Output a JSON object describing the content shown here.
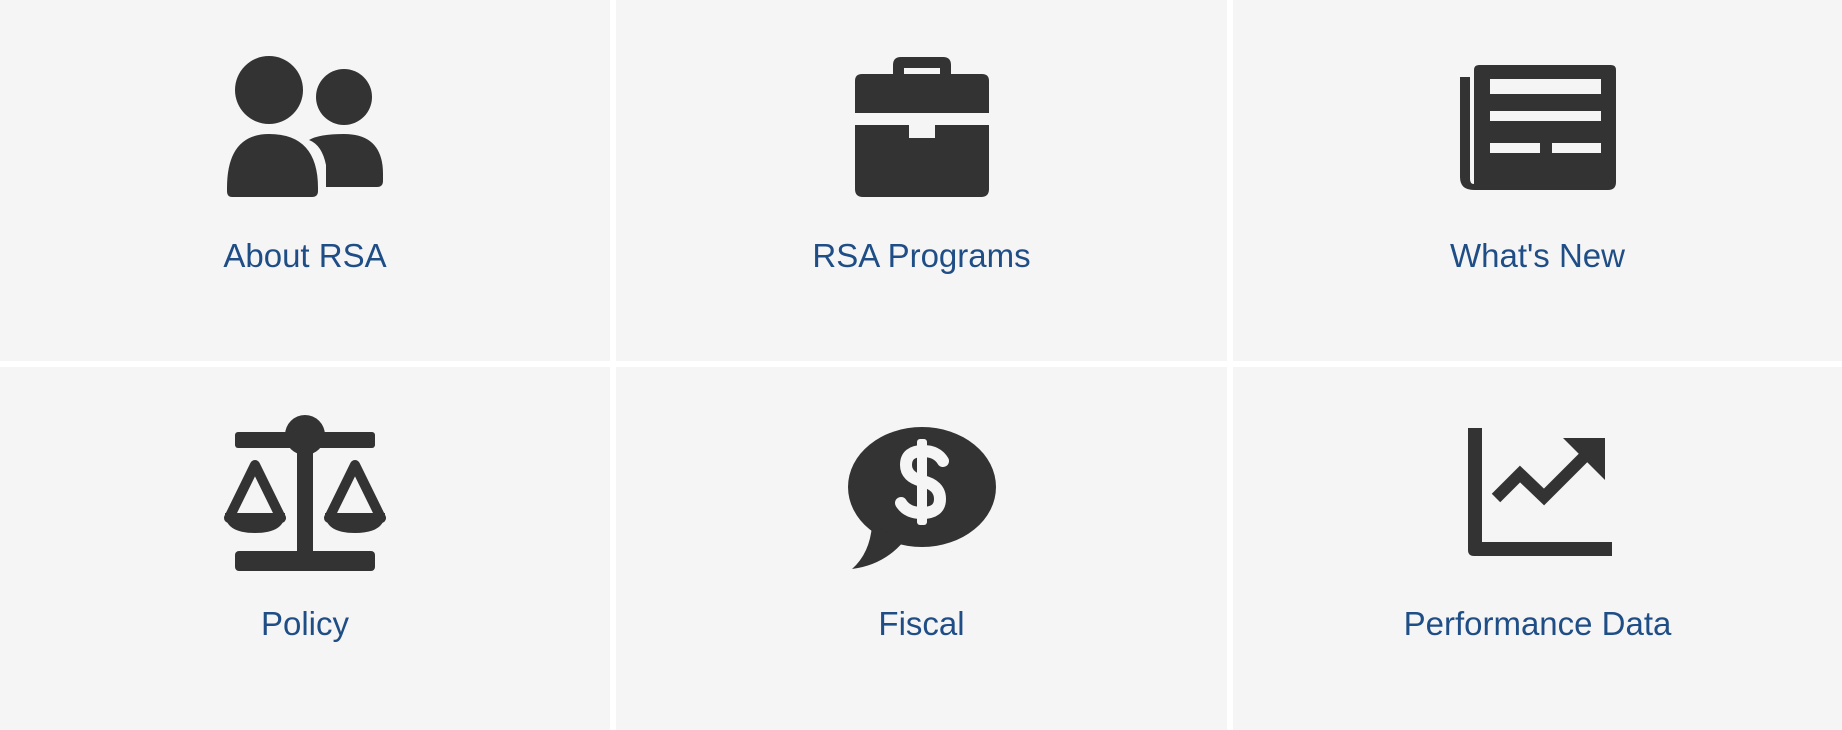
{
  "tiles": [
    {
      "label": "About RSA",
      "icon": "users-icon"
    },
    {
      "label": "RSA Programs",
      "icon": "briefcase-icon"
    },
    {
      "label": "What's New",
      "icon": "newspaper-icon"
    },
    {
      "label": "Policy",
      "icon": "scales-icon"
    },
    {
      "label": "Fiscal",
      "icon": "dollar-speech-bubble-icon"
    },
    {
      "label": "Performance Data",
      "icon": "line-chart-icon"
    }
  ],
  "colors": {
    "tile_background": "#f6f5f5",
    "label_text": "#1f4e86",
    "icon_fill": "#333333",
    "divider": "#ffffff"
  }
}
